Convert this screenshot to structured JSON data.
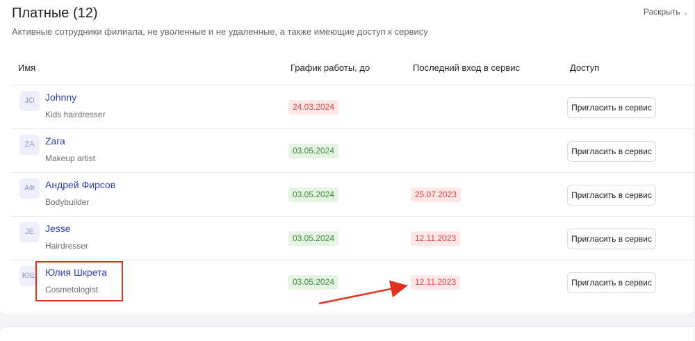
{
  "section": {
    "title": "Платные (12)",
    "subtitle": "Активные сотрудники филиала, не уволенные и не удаленные, а также имеющие доступ к сервису",
    "expand_label": "Раскрыть"
  },
  "columns": {
    "name": "Имя",
    "schedule": "График работы, до",
    "last_login": "Последний вход в сервис",
    "access": "Доступ"
  },
  "employees": [
    {
      "initials": "JO",
      "name": "Johnny",
      "role": "Kids hairdresser",
      "schedule": "24.03.2024",
      "schedule_status": "expired",
      "last_login": "",
      "invite_label": "Пригласить в сервис"
    },
    {
      "initials": "ZA",
      "name": "Zara",
      "role": "Makeup artist",
      "schedule": "03.05.2024",
      "schedule_status": "active",
      "last_login": "",
      "invite_label": "Пригласить в сервис"
    },
    {
      "initials": "АФ",
      "name": "Андрей Фирсов",
      "role": "Bodybuilder",
      "schedule": "03.05.2024",
      "schedule_status": "active",
      "last_login": "25.07.2023",
      "invite_label": "Пригласить в сервис"
    },
    {
      "initials": "JE",
      "name": "Jesse",
      "role": "Hairdresser",
      "schedule": "03.05.2024",
      "schedule_status": "active",
      "last_login": "12.11.2023",
      "invite_label": "Пригласить в сервис"
    },
    {
      "initials": "ЮШ",
      "name": "Юлия Шкрета",
      "role": "Cosmetologist",
      "schedule": "03.05.2024",
      "schedule_status": "active",
      "last_login": "12.11.2023",
      "invite_label": "Пригласить в сервис"
    }
  ],
  "colors": {
    "link": "#2f3fb0",
    "expired_bg": "#fde7e7",
    "expired_text": "#d64545",
    "active_bg": "#e5f4e3",
    "active_text": "#3e8a3a",
    "annotation": "#e0331f"
  },
  "annotations": {
    "highlight_target": "employee-name-Юлия Шкрета",
    "arrow_target": "last-login-12.11.2023"
  }
}
